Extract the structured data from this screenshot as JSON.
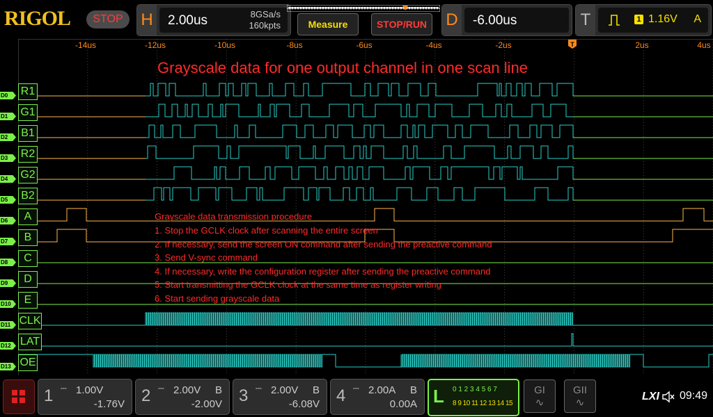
{
  "brand": {
    "logo": "RIGOL",
    "status": "STOP"
  },
  "horizontal": {
    "letter": "H",
    "timebase": "2.00us",
    "sample_rate": "8GSa/s",
    "memory_depth": "160kpts"
  },
  "buttons": {
    "measure": "Measure",
    "stop_run": "STOP/RUN"
  },
  "delay": {
    "letter": "D",
    "value": "-6.00us"
  },
  "trigger": {
    "letter": "T",
    "type_icon": "rising-edge-pulse-icon",
    "source": "1",
    "level": "1.16V",
    "mode": "A"
  },
  "time_axis": [
    "-14us",
    "-12us",
    "-10us",
    "-8us",
    "-6us",
    "-4us",
    "-2us",
    "2us",
    "4us"
  ],
  "waveform_title": "Grayscale data for one output channel in one scan line",
  "procedure": {
    "heading": "Grayscale data transmission procedure",
    "steps": [
      "1. Stop the GCLK clock after scanning the entire screen",
      "2. If necessary, send the screen ON command after sending the preactive command",
      "3. Send V-sync command",
      "4. If necessary, write the configuration register after sending the preactive command",
      "5. Start transmitting the GCLK clock at the same time as register writing",
      "6. Start sending grayscale data"
    ]
  },
  "channels": [
    {
      "tag": "D0",
      "label": "R1"
    },
    {
      "tag": "D1",
      "label": "G1"
    },
    {
      "tag": "D2",
      "label": "B1"
    },
    {
      "tag": "D3",
      "label": "R2"
    },
    {
      "tag": "D4",
      "label": "G2"
    },
    {
      "tag": "D5",
      "label": "B2"
    },
    {
      "tag": "D6",
      "label": "A"
    },
    {
      "tag": "D7",
      "label": "B"
    },
    {
      "tag": "D8",
      "label": "C"
    },
    {
      "tag": "D9",
      "label": "D"
    },
    {
      "tag": "D10",
      "label": "E"
    },
    {
      "tag": "D11",
      "label": "CLK"
    },
    {
      "tag": "D12",
      "label": "LAT"
    },
    {
      "tag": "D13",
      "label": "OE"
    }
  ],
  "analog_channels": [
    {
      "num": "1",
      "scale": "1.00V",
      "coupling": "",
      "offset": "-1.76V"
    },
    {
      "num": "2",
      "scale": "2.00V",
      "coupling": "B",
      "offset": "-2.00V"
    },
    {
      "num": "3",
      "scale": "2.00V",
      "coupling": "B",
      "offset": "-6.08V"
    },
    {
      "num": "4",
      "scale": "2.00A",
      "coupling": "B",
      "offset": "0.00A"
    }
  ],
  "logic_panel": {
    "letter": "L",
    "row1": "0 1 2 3 4 5 6 7",
    "row2": "8 9 10 11 12 13 14 15"
  },
  "generators": {
    "g1": "GI",
    "g2": "GII"
  },
  "status": {
    "lxi": "LXI",
    "time": "09:49"
  },
  "colors": {
    "digital": "#7cf04a",
    "trace": "#2ad0c8",
    "highlight": "#ffb84d",
    "accent": "#ff8a1a",
    "annotation": "#ff2a2a"
  }
}
